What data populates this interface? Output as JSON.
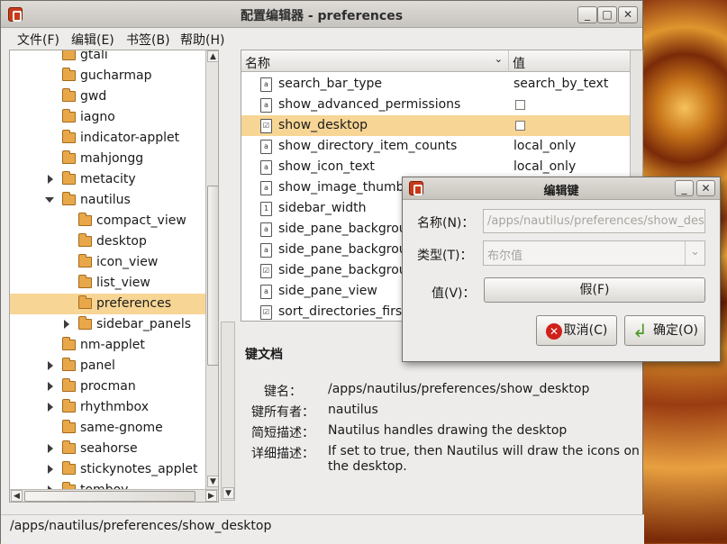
{
  "window": {
    "title": "配置编辑器 - preferences",
    "buttons": {
      "minimize": "_",
      "maximize": "□",
      "close": "✕"
    }
  },
  "menu": [
    "文件(F)",
    "编辑(E)",
    "书签(B)",
    "帮助(H)"
  ],
  "tree": {
    "items": [
      {
        "label": "gtali",
        "expander": "none",
        "level": 1
      },
      {
        "label": "gucharmap",
        "expander": "none",
        "level": 1
      },
      {
        "label": "gwd",
        "expander": "none",
        "level": 1
      },
      {
        "label": "iagno",
        "expander": "none",
        "level": 1
      },
      {
        "label": "indicator-applet",
        "expander": "none",
        "level": 1
      },
      {
        "label": "mahjongg",
        "expander": "none",
        "level": 1
      },
      {
        "label": "metacity",
        "expander": "collapsed",
        "level": 1
      },
      {
        "label": "nautilus",
        "expander": "expanded",
        "level": 1
      },
      {
        "label": "compact_view",
        "expander": "none",
        "level": 2
      },
      {
        "label": "desktop",
        "expander": "none",
        "level": 2
      },
      {
        "label": "icon_view",
        "expander": "none",
        "level": 2
      },
      {
        "label": "list_view",
        "expander": "none",
        "level": 2
      },
      {
        "label": "preferences",
        "expander": "none",
        "level": 2,
        "selected": true
      },
      {
        "label": "sidebar_panels",
        "expander": "collapsed",
        "level": 2
      },
      {
        "label": "nm-applet",
        "expander": "none",
        "level": 1
      },
      {
        "label": "panel",
        "expander": "collapsed",
        "level": 1
      },
      {
        "label": "procman",
        "expander": "collapsed",
        "level": 1
      },
      {
        "label": "rhythmbox",
        "expander": "collapsed",
        "level": 1
      },
      {
        "label": "same-gnome",
        "expander": "none",
        "level": 1
      },
      {
        "label": "seahorse",
        "expander": "collapsed",
        "level": 1
      },
      {
        "label": "stickynotes_applet",
        "expander": "collapsed",
        "level": 1
      },
      {
        "label": "tomboy",
        "expander": "collapsed",
        "level": 1
      }
    ]
  },
  "list": {
    "columns": {
      "name": "名称",
      "value": "值"
    },
    "rows": [
      {
        "name": "search_bar_type",
        "value": "search_by_text",
        "kind": "text",
        "icon": "a"
      },
      {
        "name": "show_advanced_permissions",
        "value": "",
        "kind": "checkbox",
        "icon": "a"
      },
      {
        "name": "show_desktop",
        "value": "",
        "kind": "checkbox",
        "icon": "☑",
        "selected": true
      },
      {
        "name": "show_directory_item_counts",
        "value": "local_only",
        "kind": "text",
        "icon": "a"
      },
      {
        "name": "show_icon_text",
        "value": "local_only",
        "kind": "text",
        "icon": "a"
      },
      {
        "name": "show_image_thumbn",
        "value": "",
        "kind": "text",
        "icon": "a"
      },
      {
        "name": "sidebar_width",
        "value": "",
        "kind": "text",
        "icon": "1"
      },
      {
        "name": "side_pane_backgrour",
        "value": "",
        "kind": "text",
        "icon": "a"
      },
      {
        "name": "side_pane_backgrour",
        "value": "",
        "kind": "text",
        "icon": "a"
      },
      {
        "name": "side_pane_backgrour",
        "value": "",
        "kind": "text",
        "icon": "☑"
      },
      {
        "name": "side_pane_view",
        "value": "",
        "kind": "text",
        "icon": "a"
      },
      {
        "name": "sort_directories_first",
        "value": "",
        "kind": "text",
        "icon": "☑"
      }
    ]
  },
  "doc": {
    "title": "键文档",
    "key_name_label": "键名：",
    "key_name": "/apps/nautilus/preferences/show_desktop",
    "owner_label": "键所有者：",
    "owner": "nautilus",
    "short_label": "简短描述：",
    "short_desc": "Nautilus handles drawing the desktop",
    "long_label": "详细描述：",
    "long_desc_line1": "If set to true, then Nautilus will draw the icons on",
    "long_desc_line2": "the desktop."
  },
  "status": "/apps/nautilus/preferences/show_desktop",
  "dialog": {
    "title": "编辑键",
    "name_label": "名称(N)：",
    "name_value": "/apps/nautilus/preferences/show_desk",
    "type_label": "类型(T)：",
    "type_value": "布尔值",
    "value_label": "值(V)：",
    "value_button": "假(F)",
    "cancel": "取消(C)",
    "ok": "确定(O)",
    "buttons": {
      "minimize": "_",
      "close": "✕"
    }
  },
  "colors": {
    "selection": "#f7d595",
    "titlebar": "#d3d0cb"
  }
}
